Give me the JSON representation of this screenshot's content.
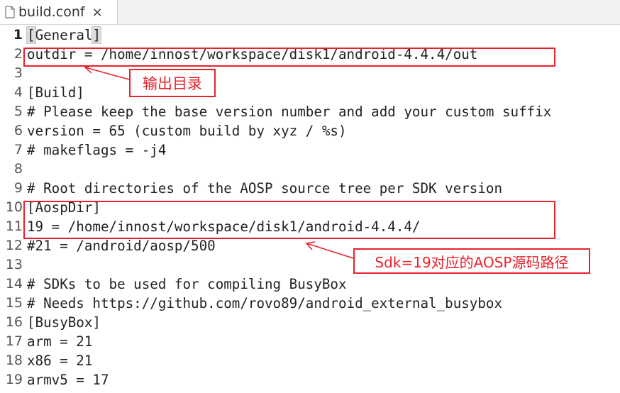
{
  "tab": {
    "title": "build.conf",
    "close_glyph": "×",
    "icon": "document-icon"
  },
  "editor": {
    "lines": [
      {
        "number": "1",
        "text": "[General]"
      },
      {
        "number": "2",
        "text": "outdir = /home/innost/workspace/disk1/android-4.4.4/out"
      },
      {
        "number": "3",
        "text": ""
      },
      {
        "number": "4",
        "text": "[Build]"
      },
      {
        "number": "5",
        "text": "# Please keep the base version number and add your custom suffix"
      },
      {
        "number": "6",
        "text": "version = 65 (custom build by xyz / %s)"
      },
      {
        "number": "7",
        "text": "# makeflags = -j4"
      },
      {
        "number": "8",
        "text": ""
      },
      {
        "number": "9",
        "text": "# Root directories of the AOSP source tree per SDK version"
      },
      {
        "number": "10",
        "text": "[AospDir]"
      },
      {
        "number": "11",
        "text": "19 = /home/innost/workspace/disk1/android-4.4.4/"
      },
      {
        "number": "12",
        "text": "#21 = /android/aosp/500"
      },
      {
        "number": "13",
        "text": ""
      },
      {
        "number": "14",
        "text": "# SDKs to be used for compiling BusyBox"
      },
      {
        "number": "15",
        "text": "# Needs https://github.com/rovo89/android_external_busybox"
      },
      {
        "number": "16",
        "text": "[BusyBox]"
      },
      {
        "number": "17",
        "text": "arm = 21"
      },
      {
        "number": "18",
        "text": "x86 = 21"
      },
      {
        "number": "19",
        "text": "armv5 = 17"
      }
    ],
    "general_bracket_open": "[",
    "general_word": "General",
    "general_bracket_close": "]"
  },
  "annotations": {
    "outdir_callout": "输出目录",
    "aospdir_callout": "Sdk=19对应的AOSP源码路径",
    "color": "#e8222a"
  }
}
